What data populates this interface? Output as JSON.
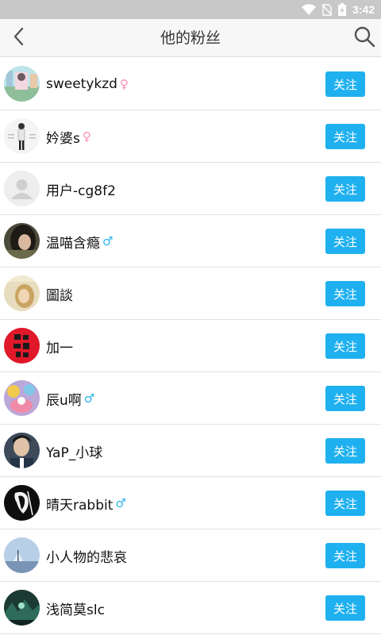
{
  "status_bar": {
    "time": "3:42",
    "icons": [
      "wifi-icon",
      "no-sim-icon",
      "battery-charging-icon"
    ]
  },
  "header": {
    "title": "他的粉丝",
    "back_icon": "chevron-left-icon",
    "search_icon": "search-icon"
  },
  "follow_label": "关注",
  "fans": [
    {
      "name": "sweetykzd",
      "gender": "female",
      "gender_symbol": "♀",
      "avatar": "photo-pastel-street"
    },
    {
      "name": "妗婆s",
      "gender": "female",
      "gender_symbol": "♀",
      "avatar": "photo-figure-white"
    },
    {
      "name": "用户-cg8f2",
      "gender": "none",
      "gender_symbol": "",
      "avatar": "default-user"
    },
    {
      "name": "温喵含瘾",
      "gender": "male",
      "gender_symbol": "♂",
      "avatar": "photo-dark-hair"
    },
    {
      "name": "圖談",
      "gender": "none",
      "gender_symbol": "",
      "avatar": "photo-warm-portrait"
    },
    {
      "name": "加一",
      "gender": "none",
      "gender_symbol": "",
      "avatar": "photo-red-calligraphy"
    },
    {
      "name": "辰u啊",
      "gender": "male",
      "gender_symbol": "♂",
      "avatar": "photo-colorful-art"
    },
    {
      "name": "YaP_小球",
      "gender": "none",
      "gender_symbol": "",
      "avatar": "photo-man-blue"
    },
    {
      "name": "晴天rabbit",
      "gender": "male",
      "gender_symbol": "♂",
      "avatar": "photo-black-white-sketch"
    },
    {
      "name": "小人物的悲哀",
      "gender": "none",
      "gender_symbol": "",
      "avatar": "photo-sky-sea"
    },
    {
      "name": "浅简莫slc",
      "gender": "none",
      "gender_symbol": "",
      "avatar": "photo-green-forest"
    }
  ],
  "colors": {
    "accent": "#1fb0ef",
    "status_bar": "#c8c8c8",
    "header_bg": "#f7f7f7",
    "female": "#ff8fb2",
    "male": "#2ab4ea"
  }
}
